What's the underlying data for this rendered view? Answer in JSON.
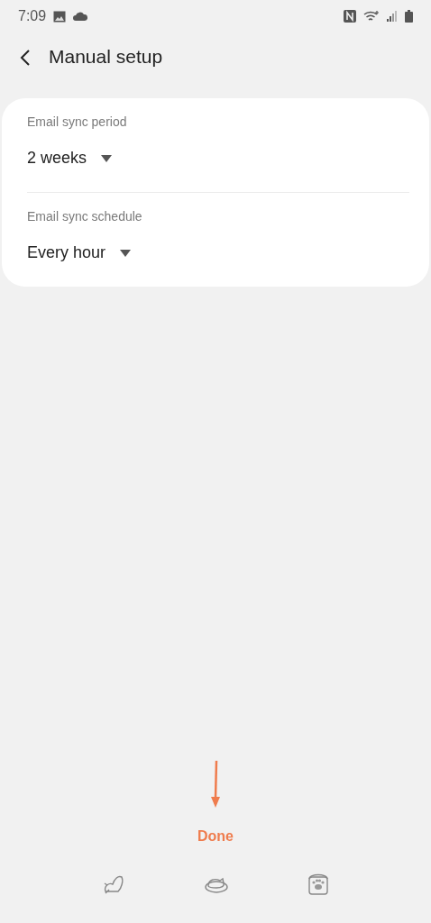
{
  "status_bar": {
    "time": "7:09"
  },
  "header": {
    "title": "Manual setup"
  },
  "settings": [
    {
      "label": "Email sync period",
      "value": "2 weeks"
    },
    {
      "label": "Email sync schedule",
      "value": "Every hour"
    }
  ],
  "done_button": "Done"
}
